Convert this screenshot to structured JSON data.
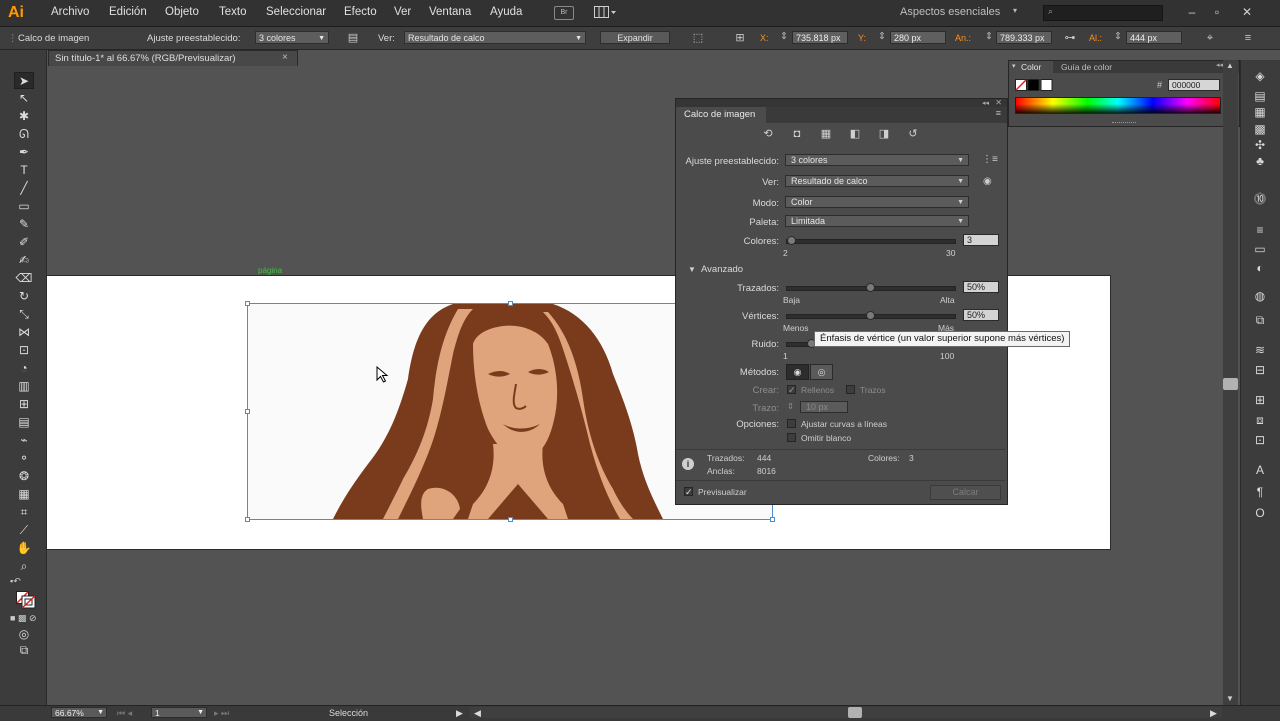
{
  "app": {
    "logo": "Ai"
  },
  "menu": [
    "Archivo",
    "Edición",
    "Objeto",
    "Texto",
    "Seleccionar",
    "Efecto",
    "Ver",
    "Ventana",
    "Ayuda"
  ],
  "menubar_badge": "Br",
  "workspace": "Aspectos esenciales",
  "control_bar": {
    "label": "Calco de imagen",
    "preset_label": "Ajuste preestablecido:",
    "preset_value": "3 colores",
    "view_label": "Ver:",
    "view_value": "Resultado de calco",
    "expand_button": "Expandir",
    "x_label": "X:",
    "x_value": "735.818 px",
    "y_label": "Y:",
    "y_value": "280 px",
    "w_label": "An.:",
    "w_value": "789.333 px",
    "h_label": "Al.:",
    "h_value": "444 px"
  },
  "document_tab": {
    "title": "Sin título-1* al 66.67% (RGB/Previsualizar)",
    "close": "×"
  },
  "artboard": {
    "page_label": "página"
  },
  "trace_panel": {
    "title": "Calco de imagen",
    "preset_label": "Ajuste preestablecido:",
    "preset_value": "3 colores",
    "view_label": "Ver:",
    "view_value": "Resultado de calco",
    "mode_label": "Modo:",
    "mode_value": "Color",
    "palette_label": "Paleta:",
    "palette_value": "Limitada",
    "colors_label": "Colores:",
    "colors_value": "3",
    "colors_min": "2",
    "colors_max": "30",
    "colors_fraction": 0.03,
    "advanced_label": "Avanzado",
    "paths_label": "Trazados:",
    "paths_value": "50%",
    "paths_min": "Baja",
    "paths_max": "Alta",
    "paths_fraction": 0.5,
    "corners_label": "Vértices:",
    "corners_value": "50%",
    "corners_min": "Menos",
    "corners_max": "Más",
    "corners_fraction": 0.5,
    "noise_label": "Ruido:",
    "noise_min": "1",
    "noise_max": "100",
    "noise_fraction": 0.15,
    "method_label": "Métodos:",
    "create_label": "Crear:",
    "fills_label": "Rellenos",
    "strokes_label": "Trazos",
    "stroke_label": "Trazo:",
    "stroke_value": "10 px",
    "options_label": "Opciones:",
    "snap_label": "Ajustar curvas a líneas",
    "ignore_white_label": "Omitir blanco",
    "stats_paths_label": "Trazados:",
    "stats_paths_value": "444",
    "stats_anchors_label": "Anclas:",
    "stats_anchors_value": "8016",
    "stats_colors_label": "Colores:",
    "stats_colors_value": "3",
    "preview_label": "Previsualizar",
    "trace_button": "Calcar"
  },
  "tooltip": "Énfasis de vértice (un valor superior supone más vértices)",
  "color_panel": {
    "tab_color": "Color",
    "tab_guide": "Guía de color",
    "hex_symbol": "#",
    "hex_value": "000000"
  },
  "status_bar": {
    "zoom": "66.67%",
    "page": "1",
    "tool": "Selección"
  },
  "colors": {
    "accent": "#ff9a00",
    "selection": "#4f8ccb",
    "hair_dark": "#7a3b1c",
    "skin": "#e0a47c",
    "bg_white": "#fafafa"
  }
}
